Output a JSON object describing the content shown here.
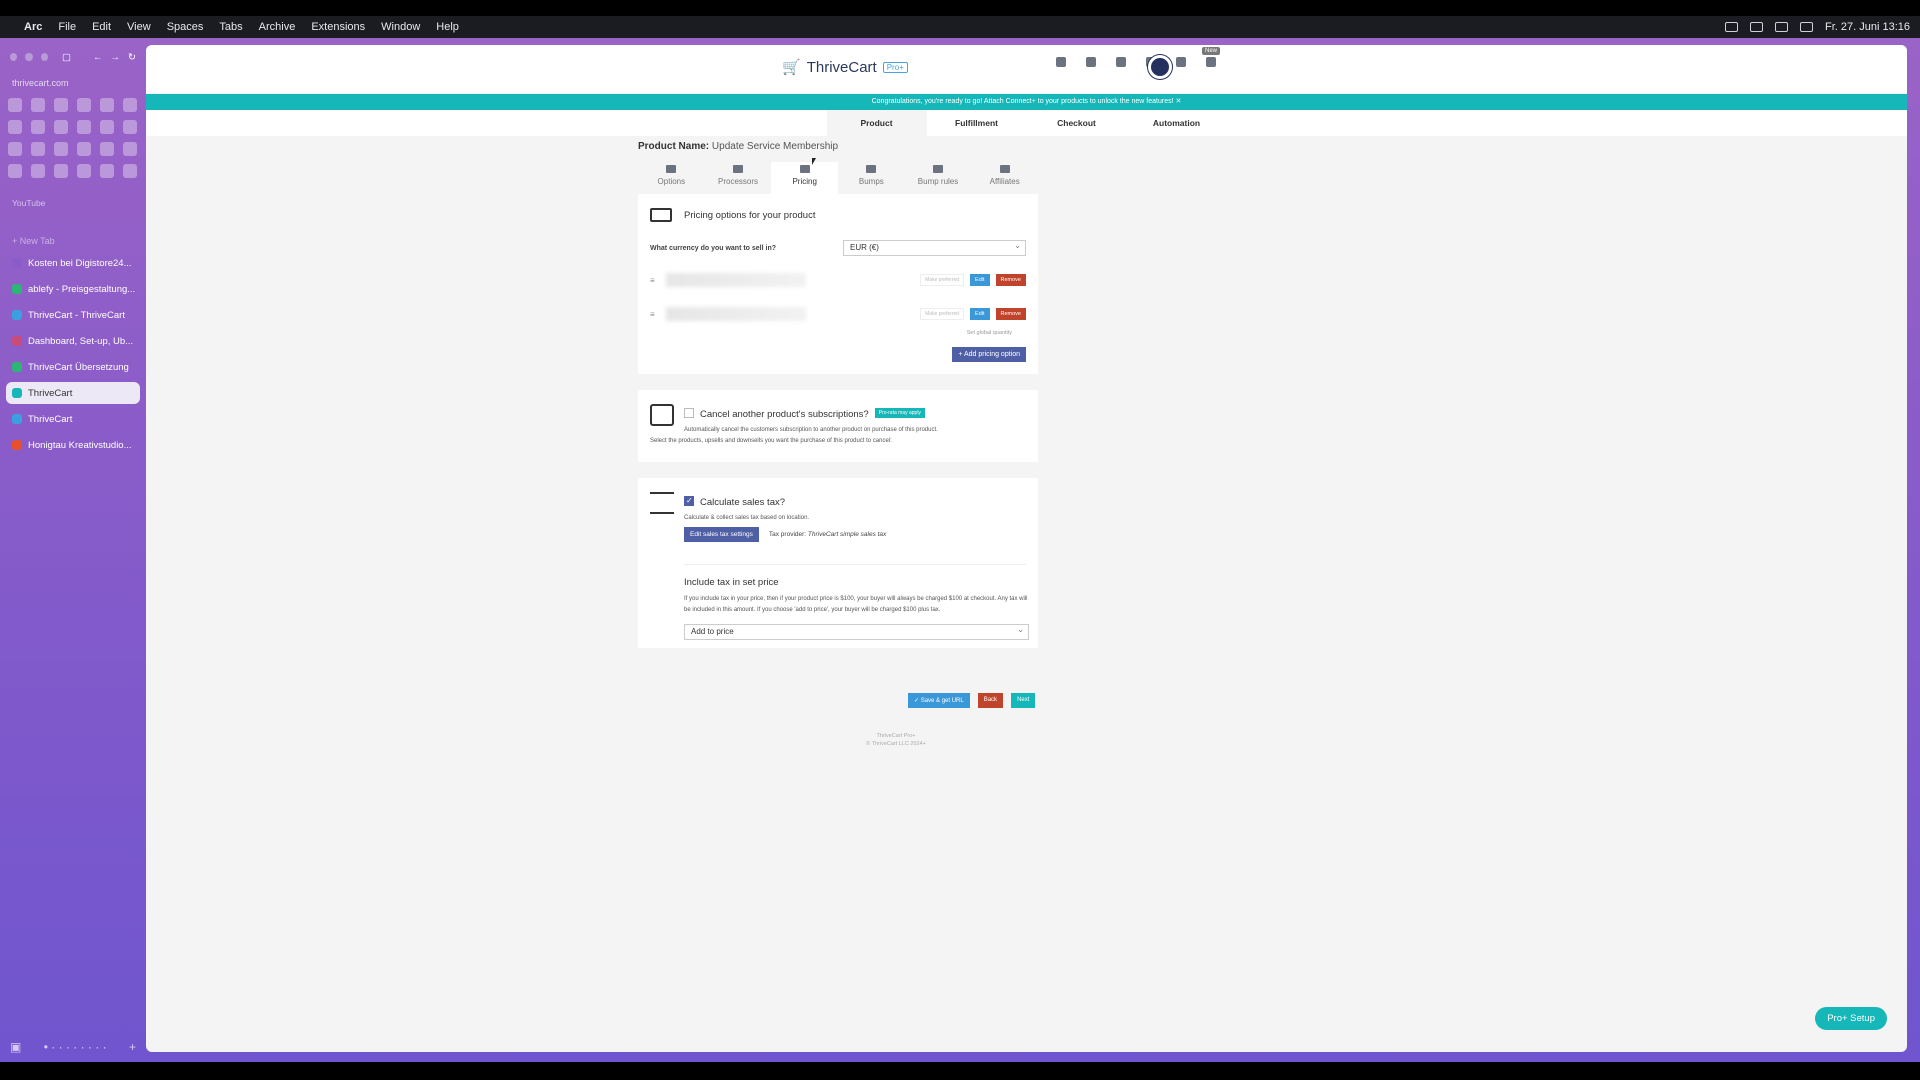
{
  "menubar": {
    "app": "Arc",
    "items": [
      "File",
      "Edit",
      "View",
      "Spaces",
      "Tabs",
      "Archive",
      "Extensions",
      "Window",
      "Help"
    ],
    "clock": "Fr. 27. Juni 13:16"
  },
  "sidebar": {
    "url": "thrivecart.com",
    "section": "YouTube",
    "new_tab": "+ New Tab",
    "tabs": [
      {
        "label": "Kosten bei Digistore24...",
        "color": "#8a5cc9"
      },
      {
        "label": "ablefy - Preisgestaltung...",
        "color": "#2bb673"
      },
      {
        "label": "ThriveCart - ThriveCart",
        "color": "#3aa0e0"
      },
      {
        "label": "Dashboard, Set-up, Ub...",
        "color": "#c94b7a"
      },
      {
        "label": "ThriveCart Übersetzung",
        "color": "#2bb673"
      },
      {
        "label": "ThriveCart",
        "color": "#15b7b9",
        "active": true
      },
      {
        "label": "ThriveCart",
        "color": "#3aa0e0"
      },
      {
        "label": "Honigtau Kreativstudio...",
        "color": "#e8502d"
      }
    ]
  },
  "header": {
    "logo_text": "ThriveCart",
    "logo_badge": "Pro+",
    "new_badge": "New"
  },
  "banner": "Congratulations, you're ready to go! Attach Connect+ to your products to unlock the new features!",
  "banner_close": "✕",
  "main_tabs": [
    "Product",
    "Fulfillment",
    "Checkout",
    "Automation"
  ],
  "product": {
    "label": "Product Name:",
    "name": "Update Service Membership"
  },
  "sub_tabs": [
    "Options",
    "Processors",
    "Pricing",
    "Bumps",
    "Bump rules",
    "Affiliates"
  ],
  "pricing": {
    "title": "Pricing options for your product",
    "currency_question": "What currency do you want to sell in?",
    "currency_value": "EUR (€)",
    "make_preferred": "Make preferred",
    "edit": "Edit",
    "remove": "Remove",
    "global_quantity": "Set global quantity",
    "add_option": "+ Add pricing option"
  },
  "cancel": {
    "label": "Cancel another product's subscriptions?",
    "badge": "Pro-rata may apply",
    "desc": "Automatically cancel the customers subscription to another product on purchase of this product.",
    "select_text": "Select the products, upsells and downsells you want the purchase of this product to cancel:"
  },
  "tax": {
    "label": "Calculate sales tax?",
    "desc": "Calculate & collect sales tax based on location.",
    "edit_btn": "Edit sales tax settings",
    "provider_label": "Tax provider:",
    "provider_value": "ThriveCart simple sales tax",
    "include_title": "Include tax in set price",
    "include_desc": "If you include tax in your price, then if your product price is $100, your buyer will always be charged $100 at checkout. Any tax will be included in this amount. If you choose 'add to price', your buyer will be charged $100 plus tax.",
    "include_value": "Add to price"
  },
  "actions": {
    "save": "✓ Save & get URL",
    "back": "Back",
    "next": "Next"
  },
  "footer": {
    "line1": "ThriveCart Pro+",
    "line2": "© ThriveCart LLC 2024+"
  },
  "pro_setup": "Pro+ Setup",
  "colors": {
    "teal": "#15b7b9",
    "indigo": "#4f5fa5",
    "edit": "#3a98d8",
    "remove": "#c0432c"
  }
}
